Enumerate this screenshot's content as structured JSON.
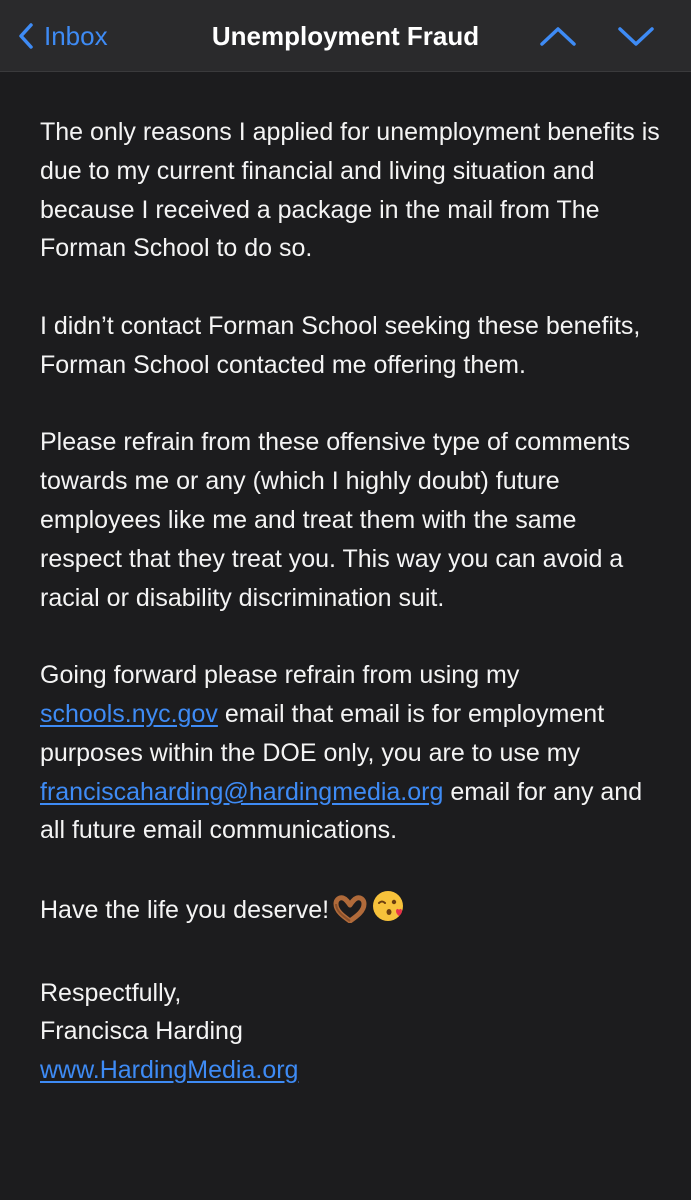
{
  "nav": {
    "back_label": "Inbox",
    "title": "Unemployment Fraud"
  },
  "colors": {
    "accent": "#3e8bf5",
    "background": "#1c1c1e",
    "navbar": "#2a2a2c",
    "text": "#f4f4f4"
  },
  "icons": [
    "chevron-left-icon",
    "chevron-up-icon",
    "chevron-down-icon",
    "heart-hands-emoji",
    "face-blowing-kiss-emoji"
  ],
  "email": {
    "p1": "The only reasons I applied for unemployment benefits is due to my current financial and living situation and because I received a package in the mail from The Forman School to do so.",
    "p2": "I didn’t contact Forman School seeking these benefits, Forman School contacted me offering them.",
    "p3": "Please refrain from these offensive type of comments towards me or any (which I highly doubt) future employees like me and treat them with the same respect that they treat you. This way you can avoid a racial or disability discrimination suit.",
    "p4_start": "Going forward please refrain from using my",
    "p4_link1": "schools.nyc.gov",
    "p4_mid": "email that email is for employment purposes within the DOE only, you are to use my",
    "p4_link2": "franciscaharding@hardingmedia.org",
    "p4_end": "email for any and all future email communications.",
    "p5": "Have the life you deserve!",
    "closing": "Respectfully,",
    "signature_name": "Francisca Harding",
    "signature_link": "www.HardingMedia.org"
  }
}
